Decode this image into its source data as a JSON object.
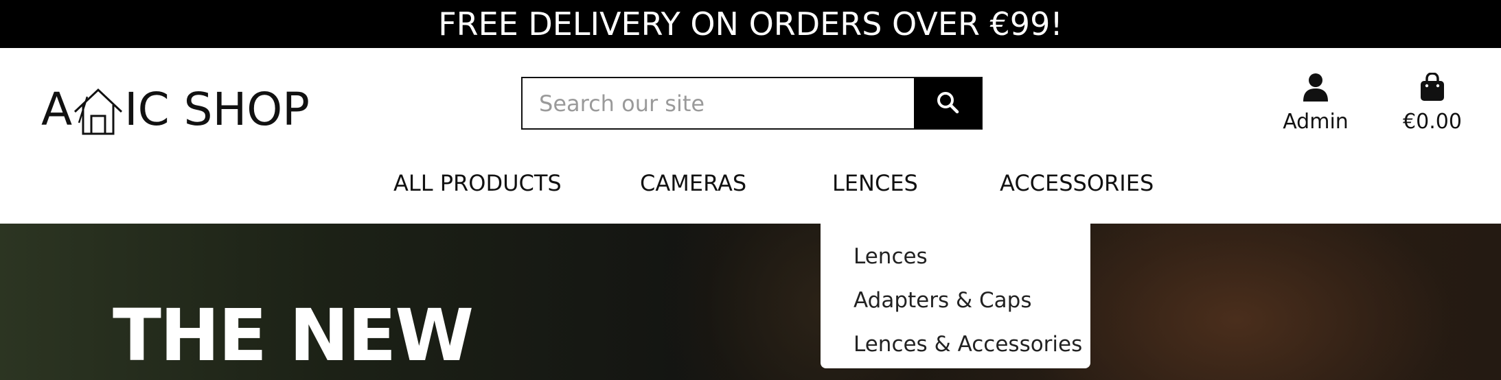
{
  "promo": {
    "text": "FREE DELIVERY ON ORDERS OVER €99!"
  },
  "header": {
    "logo": {
      "prefix": "A",
      "suffix": "IC SHOP"
    },
    "search": {
      "placeholder": "Search our site",
      "value": ""
    },
    "account": {
      "label": "Admin",
      "icon": "user-icon"
    },
    "cart": {
      "label": "€0.00",
      "icon": "shopping-bag-icon"
    }
  },
  "nav": {
    "items": [
      {
        "label": "ALL PRODUCTS"
      },
      {
        "label": "CAMERAS"
      },
      {
        "label": "LENCES"
      },
      {
        "label": "ACCESSORIES"
      }
    ]
  },
  "dropdown": {
    "items": [
      {
        "label": "Lences"
      },
      {
        "label": "Adapters & Caps"
      },
      {
        "label": "Lences & Accessories"
      }
    ]
  },
  "hero": {
    "title": "THE NEW"
  },
  "colors": {
    "promo_bg": "#000000",
    "search_button": "#000000",
    "text": "#111111"
  }
}
